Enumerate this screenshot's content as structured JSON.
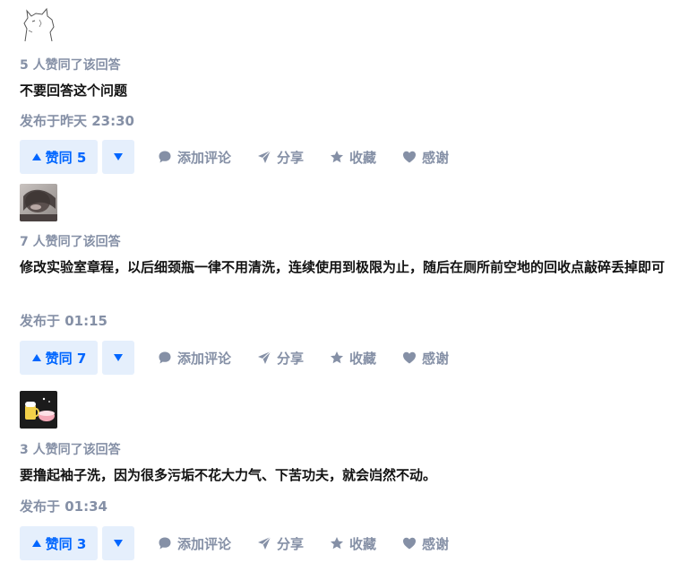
{
  "answers": [
    {
      "votes_text": "5 人赞同了该回答",
      "content": "不要回答这个问题",
      "time": "发布于昨天 23:30",
      "vote_label": "赞同 5"
    },
    {
      "votes_text": "7 人赞同了该回答",
      "content": "修改实验室章程，以后细颈瓶一律不用清洗，连续使用到极限为止，随后在厕所前空地的回收点敲碎丢掉即可",
      "time": "发布于 01:15",
      "vote_label": "赞同 7"
    },
    {
      "votes_text": "3 人赞同了该回答",
      "content": "要撸起袖子洗，因为很多污垢不花大力气、下苦功夫，就会岿然不动。",
      "time": "发布于 01:34",
      "vote_label": "赞同 3"
    }
  ],
  "actions": {
    "comment": "添加评论",
    "share": "分享",
    "collect": "收藏",
    "thanks": "感谢"
  },
  "colors": {
    "accent": "#0066ff",
    "vote_bg": "#e5effc",
    "meta": "#8590a6"
  }
}
